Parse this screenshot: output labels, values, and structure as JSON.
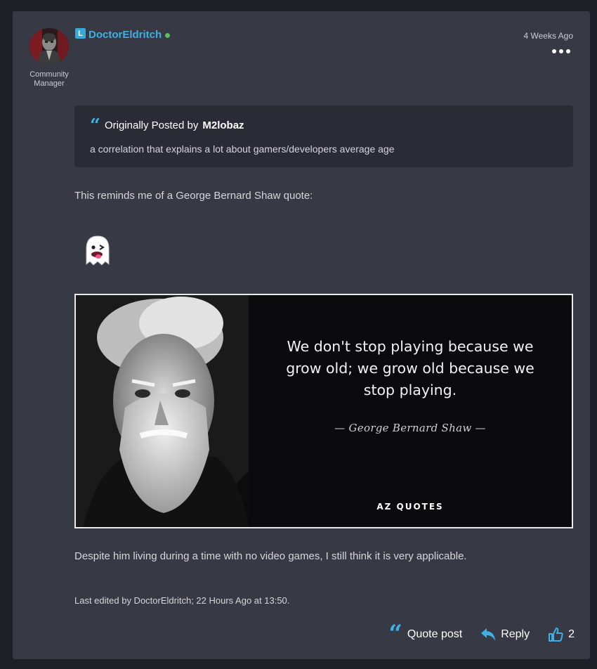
{
  "post": {
    "author": {
      "name": "DoctorEldritch",
      "badge": "L",
      "rank": "Community Manager",
      "online": true
    },
    "timestamp": "4 Weeks Ago",
    "quote": {
      "prefix": "Originally Posted by",
      "author": "M2lobaz",
      "text": "a correlation that explains a lot about gamers/developers average age"
    },
    "paragraph1": "This reminds me of a George Bernard Shaw quote:",
    "image": {
      "quote": "We don't stop playing because we grow old; we grow old because we stop playing.",
      "quote_lines": [
        "We don't stop playing because we",
        "grow old; we grow old because we",
        "stop playing."
      ],
      "author": "— George Bernard Shaw —",
      "brand": "AZ QUOTES"
    },
    "paragraph2": "Despite him living during a time with no video games, I still think it is very applicable.",
    "edited_note": "Last edited by DoctorEldritch; 22 Hours Ago at 13:50.",
    "actions": {
      "quote_label": "Quote post",
      "reply_label": "Reply",
      "like_count": "2"
    }
  },
  "colors": {
    "accent": "#3fb0e3",
    "post_bg": "#373a45",
    "page_bg": "#1e2027",
    "quote_bg": "#2a2c35",
    "online": "#5dbb5c"
  },
  "icons": [
    "avatar",
    "online-dot",
    "more-icon",
    "quote-icon",
    "ghost-emoji",
    "reply-icon",
    "thumbs-up-icon"
  ]
}
